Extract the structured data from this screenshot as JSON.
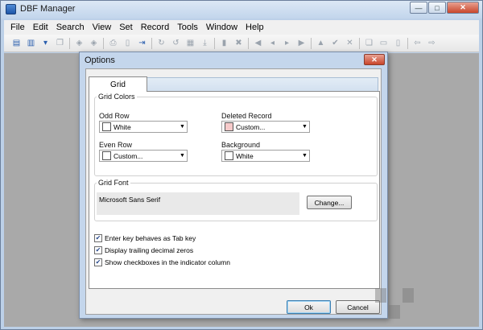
{
  "window": {
    "title": "DBF Manager",
    "controls": {
      "minimize": "—",
      "maximize": "□",
      "close": "✕"
    }
  },
  "menu": [
    "File",
    "Edit",
    "Search",
    "View",
    "Set",
    "Record",
    "Tools",
    "Window",
    "Help"
  ],
  "toolbar": {
    "icons": [
      "open-db-icon",
      "save-db-icon",
      "dropdown-arrow-icon",
      "copy-icon",
      "back-icon",
      "forward-icon",
      "print-icon",
      "preview-icon",
      "export-icon",
      "refresh-icon",
      "refresh-all-icon",
      "filter-icon",
      "download-icon",
      "delete-icon",
      "pack-icon",
      "first-record-icon",
      "prev-record-icon",
      "next-record-icon",
      "last-record-icon",
      "insert-icon",
      "confirm-icon",
      "cancel-icon",
      "window-cascade-icon",
      "window-tile-h-icon",
      "window-tile-v-icon",
      "nav-back-icon",
      "nav-forward-icon"
    ]
  },
  "dialog": {
    "title": "Options",
    "close": "✕",
    "tab": "Grid",
    "grid_colors": {
      "group_label": "Grid Colors",
      "odd_row": {
        "label": "Odd Row",
        "value": "White",
        "swatch": "#ffffff"
      },
      "deleted_record": {
        "label": "Deleted Record",
        "value": "Custom...",
        "swatch": "#f6caca"
      },
      "even_row": {
        "label": "Even Row",
        "value": "Custom...",
        "swatch": "#ffffff"
      },
      "background": {
        "label": "Background",
        "value": "White",
        "swatch": "#ffffff"
      }
    },
    "grid_font": {
      "group_label": "Grid Font",
      "font_name": "Microsoft Sans Serif",
      "change_button": "Change..."
    },
    "options": [
      {
        "label": "Enter key behaves as Tab key",
        "checked": true
      },
      {
        "label": "Display trailing decimal zeros",
        "checked": true
      },
      {
        "label": "Show checkboxes in the indicator column",
        "checked": true
      }
    ],
    "buttons": {
      "ok": "Ok",
      "cancel": "Cancel"
    }
  },
  "colors": {
    "window_frame": "#bcd0e8",
    "mdi_background": "#a9a9a9",
    "dialog_frame": "#c4d6ec",
    "deleted_record_swatch": "#f6caca"
  }
}
